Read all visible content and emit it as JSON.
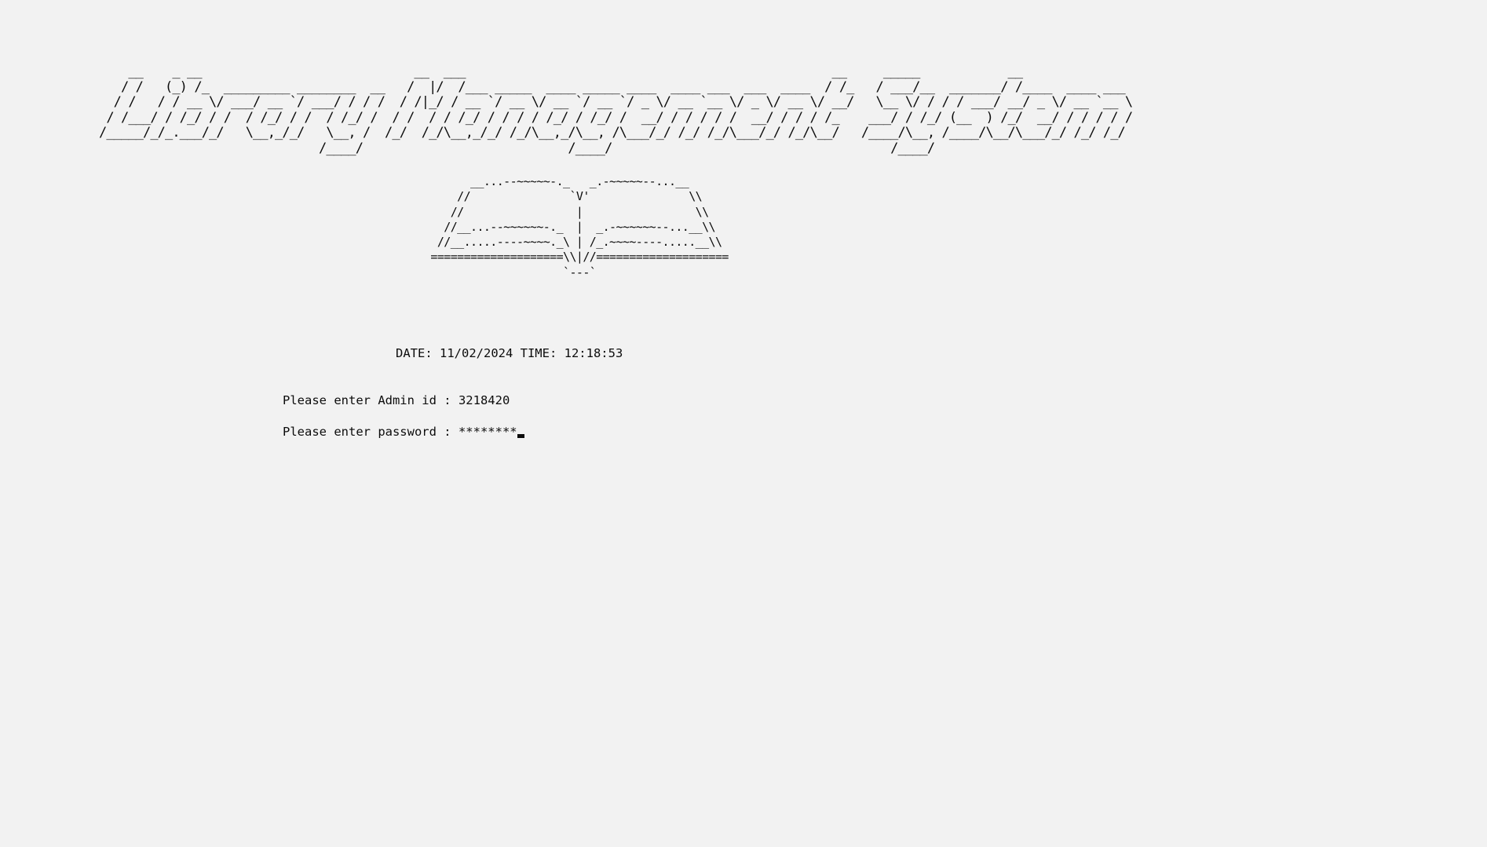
{
  "console": {
    "banner_art": "    __    _ __                             __  ___                                                  __     _____            __                   \n   / /   (_) /_  _________ ________  __   /  |/  /___ _____  ____ _____ ____  ____ ___  ___  ____  / /_   / ___/__  _______/ /____  ____ ___ \n  / /   / / __ \\/ ___/ __ `/ ___/ / / /  / /|_/ / __ `/ __ \\/ __ `/ __ `/ _ \\/ __ `__ \\/ _ \\/ __ \\/ __/   \\__ \\/ / / / ___/ __/ _ \\/ __ `__ \\\n / /___/ / /_/ / /  / /_/ / /  / /_/ /  / /  / / /_/ / / / / /_/ / /_/ /  __/ / / / / /  __/ / / / /_    ___/ / /_/ (__  ) /_/  __/ / / / / /\n/_____/_/_.___/_/   \\__,_/_/   \\__, /  /_/  /_/\\__,_/_/ /_/\\__,_/\\__, /\\___/_/ /_/ /_/\\___/_/ /_/\\__/   /____/\\__, /____/\\__/\\___/_/ /_/ /_/ \n                              /____/                            /____/                                      /____/                           ",
    "book_art": "       __...--~~~~~-._   _.-~~~~~--...__\n     //               `V'               \\\\\n    //                 |                 \\\\\n   //__...--~~~~~~-._  |  _.-~~~~~~--...__\\\\\n  //__.....----~~~~._\\ | /_.~~~~----.....__\\\\\n ====================\\\\|//====================\n                     `---`",
    "datetime_text": "DATE: 11/02/2024 TIME: 12:18:53",
    "admin_prompt": "Please enter Admin id : ",
    "admin_value": "3218420",
    "password_prompt": "Please enter password : ",
    "password_value": "********"
  }
}
